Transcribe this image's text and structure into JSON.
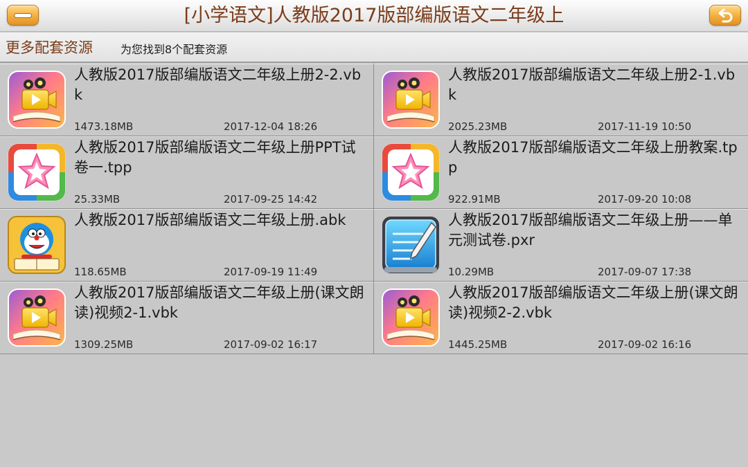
{
  "header": {
    "title": "[小学语文]人教版2017版部编版语文二年级上",
    "menu_icon": "menu-icon",
    "back_icon": "back-arrow-icon"
  },
  "subheader": {
    "section_label": "更多配套资源",
    "result_text": "为您找到8个配套资源"
  },
  "colors": {
    "title_text": "#7a3c1a",
    "button_orange": "#f2ae3c",
    "background": "#c9c9c9"
  },
  "resources": [
    {
      "name": "人教版2017版部编版语文二年级上册2-2.vbk",
      "size": "1473.18MB",
      "date": "2017-12-04 18:26",
      "icon": "video-book-icon"
    },
    {
      "name": "人教版2017版部编版语文二年级上册2-1.vbk",
      "size": "2025.23MB",
      "date": "2017-11-19 10:50",
      "icon": "video-book-icon"
    },
    {
      "name": "人教版2017版部编版语文二年级上册PPT试卷一.tpp",
      "size": "25.33MB",
      "date": "2017-09-25 14:42",
      "icon": "star-presentation-icon"
    },
    {
      "name": "人教版2017版部编版语文二年级上册教案.tpp",
      "size": "922.91MB",
      "date": "2017-09-20 10:08",
      "icon": "star-presentation-icon"
    },
    {
      "name": "人教版2017版部编版语文二年级上册.abk",
      "size": "118.65MB",
      "date": "2017-09-19 11:49",
      "icon": "cartoon-book-icon"
    },
    {
      "name": "人教版2017版部编版语文二年级上册——单元测试卷.pxr",
      "size": "10.29MB",
      "date": "2017-09-07 17:38",
      "icon": "notepad-pen-icon"
    },
    {
      "name": "人教版2017版部编版语文二年级上册(课文朗读)视频2-1.vbk",
      "size": "1309.25MB",
      "date": "2017-09-02 16:17",
      "icon": "video-book-icon"
    },
    {
      "name": "人教版2017版部编版语文二年级上册(课文朗读)视频2-2.vbk",
      "size": "1445.25MB",
      "date": "2017-09-02 16:16",
      "icon": "video-book-icon"
    }
  ]
}
